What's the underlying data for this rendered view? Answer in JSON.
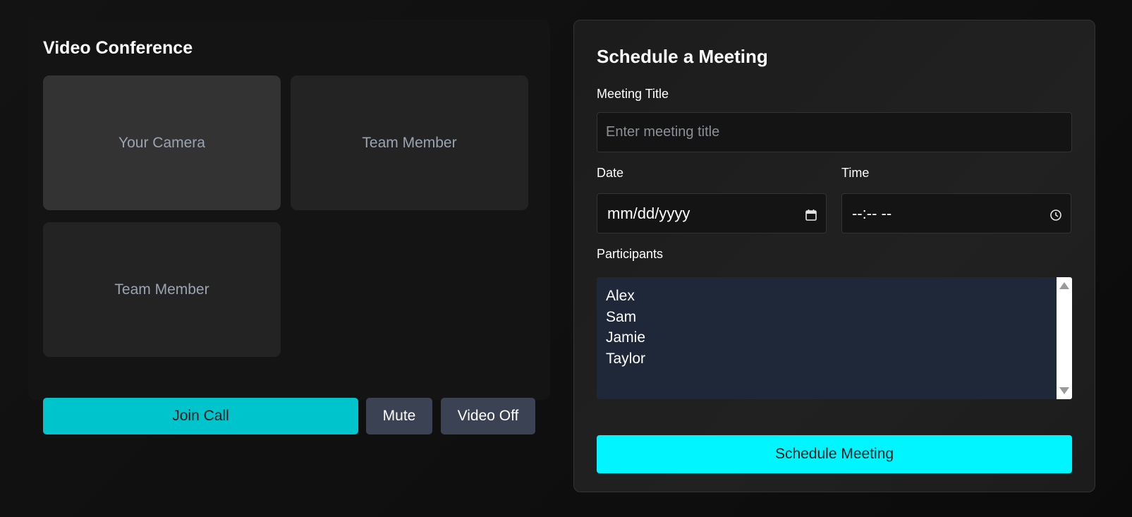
{
  "video": {
    "title": "Video Conference",
    "tiles": [
      {
        "label": "Your Camera"
      },
      {
        "label": "Team Member"
      },
      {
        "label": "Team Member"
      }
    ],
    "buttons": {
      "join": "Join Call",
      "mute": "Mute",
      "video_off": "Video Off"
    }
  },
  "schedule": {
    "title": "Schedule a Meeting",
    "meeting_title_label": "Meeting Title",
    "meeting_title_placeholder": "Enter meeting title",
    "date_label": "Date",
    "date_value": "mm/dd/yyyy",
    "date_icon": "calendar-icon",
    "time_label": "Time",
    "time_value": "--:-- --",
    "time_icon": "clock-icon",
    "participants_label": "Participants",
    "participants": [
      "Alex",
      "Sam",
      "Jamie",
      "Taylor"
    ],
    "submit": "Schedule Meeting"
  },
  "colors": {
    "join_button": "#00c4cc",
    "schedule_button": "#00f5ff",
    "secondary_button": "#3a4253",
    "participants_bg": "#1f2839"
  }
}
